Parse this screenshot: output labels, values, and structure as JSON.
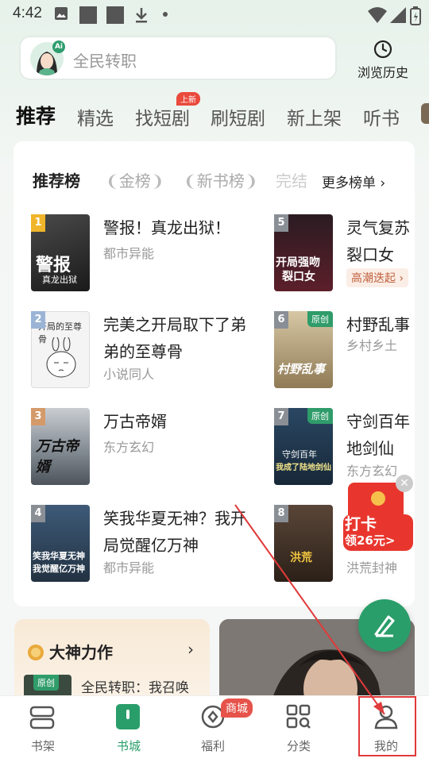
{
  "status_bar": {
    "time": "4:42"
  },
  "search": {
    "placeholder": "全民转职",
    "ai_badge": "Ai"
  },
  "history": {
    "label": "浏览历史"
  },
  "tabs": [
    {
      "label": "推荐",
      "active": true
    },
    {
      "label": "精选"
    },
    {
      "label": "找短剧",
      "badge": "上新"
    },
    {
      "label": "刷短剧"
    },
    {
      "label": "新上架"
    },
    {
      "label": "听书"
    }
  ],
  "rank": {
    "tabs": [
      "推荐榜",
      "金榜",
      "新书榜",
      "完结"
    ],
    "more": "更多榜单 ›"
  },
  "books_left": [
    {
      "rank": "1",
      "title": "警报！真龙出狱！",
      "genre": "都市异能",
      "cover_text": "警报",
      "cover_sub": "真龙出狱"
    },
    {
      "rank": "2",
      "title": "完美之开局取下了弟弟的至尊骨",
      "genre": "小说同人",
      "cover_text": "开局的至尊骨"
    },
    {
      "rank": "3",
      "title": "万古帝婿",
      "genre": "东方玄幻",
      "cover_text": "万古帝婿"
    },
    {
      "rank": "4",
      "title": "笑我华夏无神？我开局觉醒亿万神",
      "genre": "都市异能",
      "cover_text": "笑我华夏无神",
      "cover_sub": "我觉醒亿万神"
    }
  ],
  "books_right": [
    {
      "rank": "5",
      "title": "灵气复苏裂口女",
      "genre": "",
      "hot": "高潮迭起 ›",
      "cover_text": "开局强吻",
      "cover_sub": "裂口女"
    },
    {
      "rank": "6",
      "title": "村野乱事",
      "genre": "乡村乡土",
      "original": "原创",
      "cover_text": "村野乱事"
    },
    {
      "rank": "7",
      "title": "守剑百年地剑仙",
      "genre": "东方玄幻",
      "original": "原创",
      "cover_text": "守剑百年",
      "cover_sub": "我成了陆地剑仙"
    },
    {
      "rank": "8",
      "title": "洪荒封神",
      "genre": "洪荒封神",
      "cover_text": "洪荒"
    }
  ],
  "dashen": {
    "title": "大神力作",
    "arrow": "›",
    "item_tag": "原创",
    "item_title": "全民转职：我召唤"
  },
  "redpack": {
    "line1": "打卡",
    "line2": "领26元>"
  },
  "bottom_nav": [
    {
      "label": "书架",
      "icon": "bookshelf-icon"
    },
    {
      "label": "书城",
      "icon": "bookstore-icon",
      "active": true
    },
    {
      "label": "福利",
      "icon": "welfare-icon",
      "badge": "商城"
    },
    {
      "label": "分类",
      "icon": "category-icon"
    },
    {
      "label": "我的",
      "icon": "profile-icon"
    }
  ],
  "colors": {
    "accent": "#2a9e6a",
    "badge_red": "#e94a3c",
    "highlight": "#e03a3a"
  }
}
